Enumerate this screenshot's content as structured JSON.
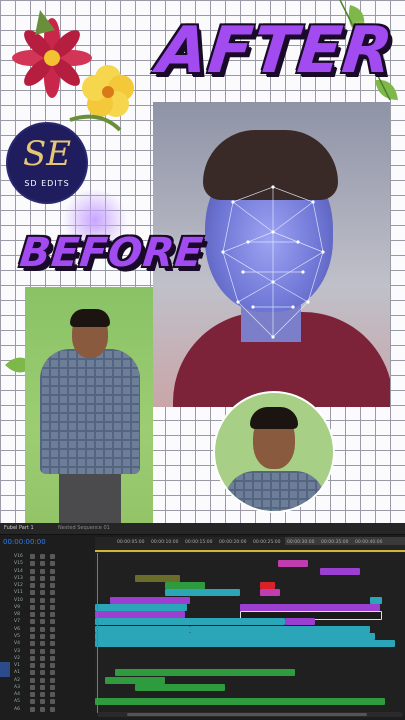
{
  "overlay": {
    "after_label": "AFTER",
    "before_label": "BEFORE",
    "logo_monogram": "SE",
    "logo_text": "SD EDITS"
  },
  "editor": {
    "tab_1": "Fubel Part 1",
    "tab_2": "Nested Sequence 01",
    "timecode": "00:00:00:00",
    "ruler_labels": [
      "00:00:05:00",
      "00:00:10:00",
      "00:00:15:00",
      "00:00:20:00",
      "00:00:25:00",
      "00:00:30:00",
      "00:00:35:00",
      "00:00:40:00"
    ],
    "video_tracks": [
      "V16",
      "V15",
      "V14",
      "V13",
      "V12",
      "V11",
      "V10",
      "V9",
      "V8",
      "V7",
      "V6",
      "V5",
      "V4",
      "V3",
      "V2",
      "V1"
    ],
    "audio_tracks": [
      "A1",
      "A2",
      "A3",
      "A4",
      "A5",
      "A6"
    ],
    "colors": {
      "accent": "#3f7ef2",
      "clip_teal": "#2aa6b8",
      "clip_purple": "#9a3fd0",
      "clip_green": "#2d9b3e",
      "clip_olive": "#6a6d2a",
      "clip_magenta": "#c03db0",
      "clip_red": "#d9212a"
    }
  }
}
